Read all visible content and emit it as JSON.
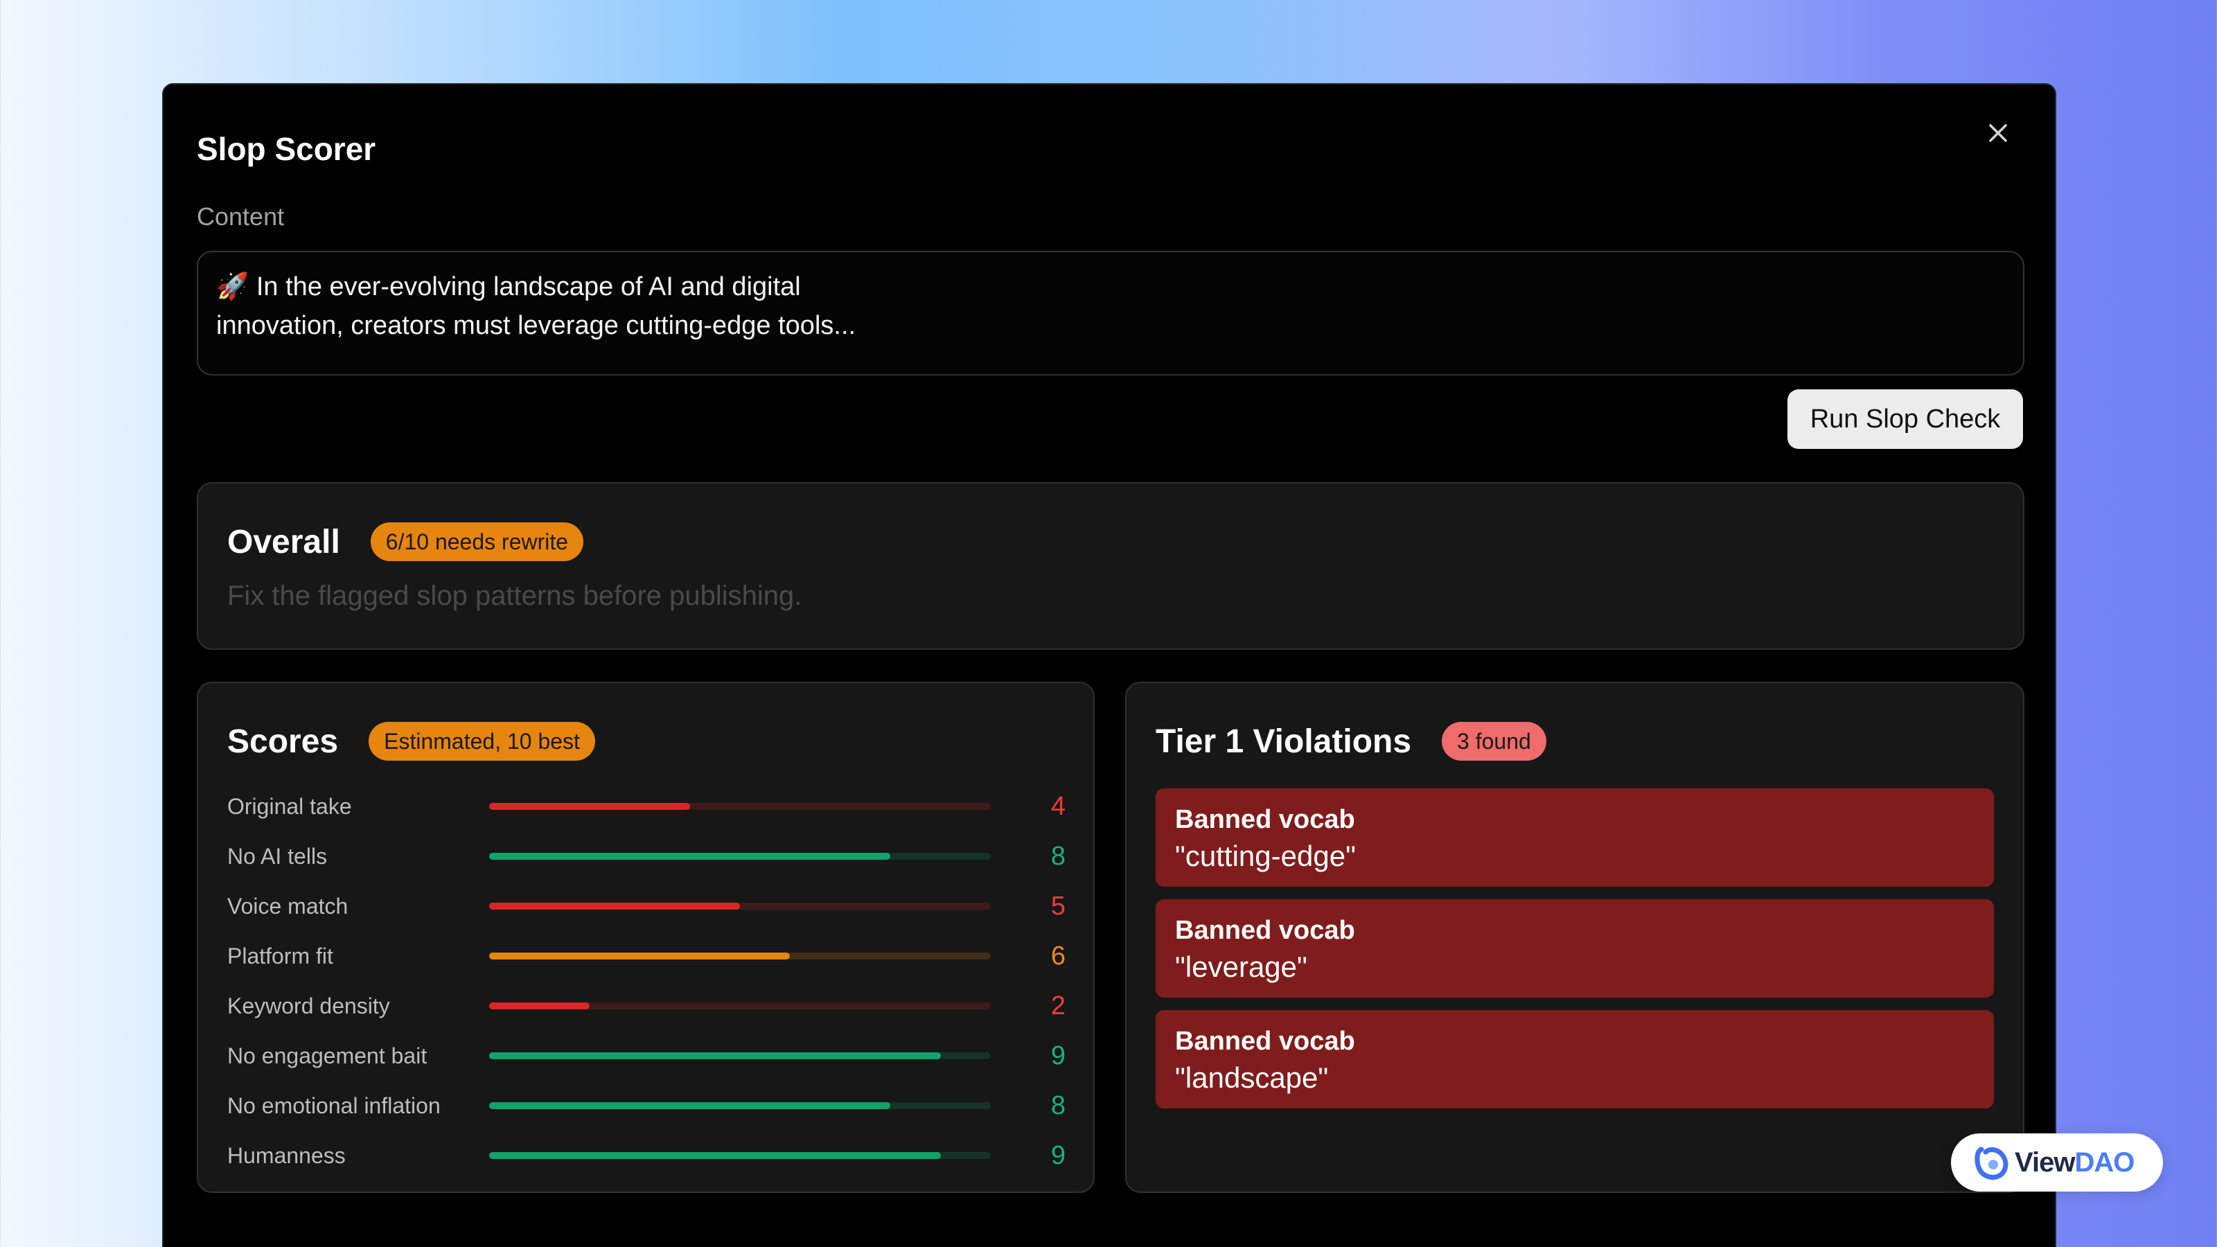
{
  "modal": {
    "title": "Slop Scorer",
    "content_label": "Content",
    "content_value": "🚀 In the ever-evolving landscape of AI and digital\ninnovation, creators must leverage cutting-edge tools...",
    "run_button": "Run Slop Check",
    "close_icon": "close-icon"
  },
  "overall": {
    "title": "Overall",
    "badge": "6/10 needs rewrite",
    "description": "Fix the flagged slop patterns before publishing."
  },
  "scores": {
    "title": "Scores",
    "badge": "Estinmated, 10 best",
    "max": 10,
    "items": [
      {
        "label": "Original take",
        "value": "4",
        "score": 4,
        "color": "#dc2626"
      },
      {
        "label": "No AI tells",
        "value": "8",
        "score": 8,
        "color": "#10a36a"
      },
      {
        "label": "Voice match",
        "value": "5",
        "score": 5,
        "color": "#dc2626"
      },
      {
        "label": "Platform fit",
        "value": "6",
        "score": 6,
        "color": "#e6850f"
      },
      {
        "label": "Keyword density",
        "value": "2",
        "score": 2,
        "color": "#dc2626"
      },
      {
        "label": "No engagement bait",
        "value": "9",
        "score": 9,
        "color": "#10a36a"
      },
      {
        "label": "No emotional inflation",
        "value": "8",
        "score": 8,
        "color": "#10a36a"
      },
      {
        "label": "Humanness",
        "value": "9",
        "score": 9,
        "color": "#10a36a"
      }
    ]
  },
  "violations": {
    "title": "Tier 1 Violations",
    "badge": "3 found",
    "items": [
      {
        "type": "Banned vocab",
        "term": "\"cutting-edge\""
      },
      {
        "type": "Banned vocab",
        "term": "\"leverage\""
      },
      {
        "type": "Banned vocab",
        "term": "\"landscape\""
      }
    ]
  },
  "watermark": {
    "view": "View",
    "dao": "DAO"
  }
}
